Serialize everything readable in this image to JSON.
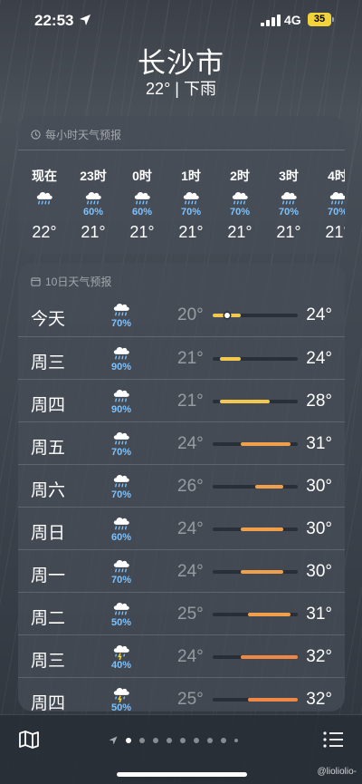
{
  "status_bar": {
    "time": "22:53",
    "network": "4G",
    "battery": "35",
    "battery_color": "#f2d33a"
  },
  "header": {
    "city": "长沙市",
    "summary": "22° | 下雨"
  },
  "hourly": {
    "title": "每小时天气预报",
    "items": [
      {
        "time": "现在",
        "icon": "rain-cloud-icon",
        "pop": "",
        "temp": "22°"
      },
      {
        "time": "23时",
        "icon": "rain-cloud-icon",
        "pop": "60%",
        "temp": "21°"
      },
      {
        "time": "0时",
        "icon": "rain-cloud-icon",
        "pop": "60%",
        "temp": "21°"
      },
      {
        "time": "1时",
        "icon": "rain-cloud-icon",
        "pop": "70%",
        "temp": "21°"
      },
      {
        "time": "2时",
        "icon": "rain-cloud-icon",
        "pop": "70%",
        "temp": "21°"
      },
      {
        "time": "3时",
        "icon": "rain-cloud-icon",
        "pop": "70%",
        "temp": "21°"
      },
      {
        "time": "4时",
        "icon": "rain-cloud-icon",
        "pop": "70%",
        "temp": "21°"
      }
    ]
  },
  "daily": {
    "title": "10日天气预报",
    "range_min": 20,
    "range_max": 32,
    "current_temp": 22,
    "items": [
      {
        "day": "今天",
        "icon": "rain-cloud-icon",
        "pop": "70%",
        "low": "20°",
        "high": "24°",
        "low_v": 20,
        "high_v": 24,
        "color": "#f2c94c"
      },
      {
        "day": "周三",
        "icon": "rain-cloud-icon",
        "pop": "90%",
        "low": "21°",
        "high": "24°",
        "low_v": 21,
        "high_v": 24,
        "color": "#f2c94c"
      },
      {
        "day": "周四",
        "icon": "rain-cloud-icon",
        "pop": "90%",
        "low": "21°",
        "high": "28°",
        "low_v": 21,
        "high_v": 28,
        "color": "#f2c94c"
      },
      {
        "day": "周五",
        "icon": "rain-cloud-icon",
        "pop": "70%",
        "low": "24°",
        "high": "31°",
        "low_v": 24,
        "high_v": 31,
        "color": "#f0a04b"
      },
      {
        "day": "周六",
        "icon": "rain-cloud-icon",
        "pop": "70%",
        "low": "26°",
        "high": "30°",
        "low_v": 26,
        "high_v": 30,
        "color": "#f0a04b"
      },
      {
        "day": "周日",
        "icon": "rain-cloud-icon",
        "pop": "60%",
        "low": "24°",
        "high": "30°",
        "low_v": 24,
        "high_v": 30,
        "color": "#f0a04b"
      },
      {
        "day": "周一",
        "icon": "rain-cloud-icon",
        "pop": "70%",
        "low": "24°",
        "high": "30°",
        "low_v": 24,
        "high_v": 30,
        "color": "#f0a04b"
      },
      {
        "day": "周二",
        "icon": "rain-cloud-icon",
        "pop": "50%",
        "low": "25°",
        "high": "31°",
        "low_v": 25,
        "high_v": 31,
        "color": "#f0a04b"
      },
      {
        "day": "周三",
        "icon": "thunderstorm-cloud-icon",
        "pop": "40%",
        "low": "24°",
        "high": "32°",
        "low_v": 24,
        "high_v": 32,
        "color": "#ee8844"
      },
      {
        "day": "周四",
        "icon": "thunderstorm-cloud-icon",
        "pop": "50%",
        "low": "25°",
        "high": "32°",
        "low_v": 25,
        "high_v": 32,
        "color": "#ee8844"
      }
    ]
  },
  "bottom_bar": {
    "page_count": 9,
    "active_page": 1
  },
  "watermark": "@liolioliο-"
}
